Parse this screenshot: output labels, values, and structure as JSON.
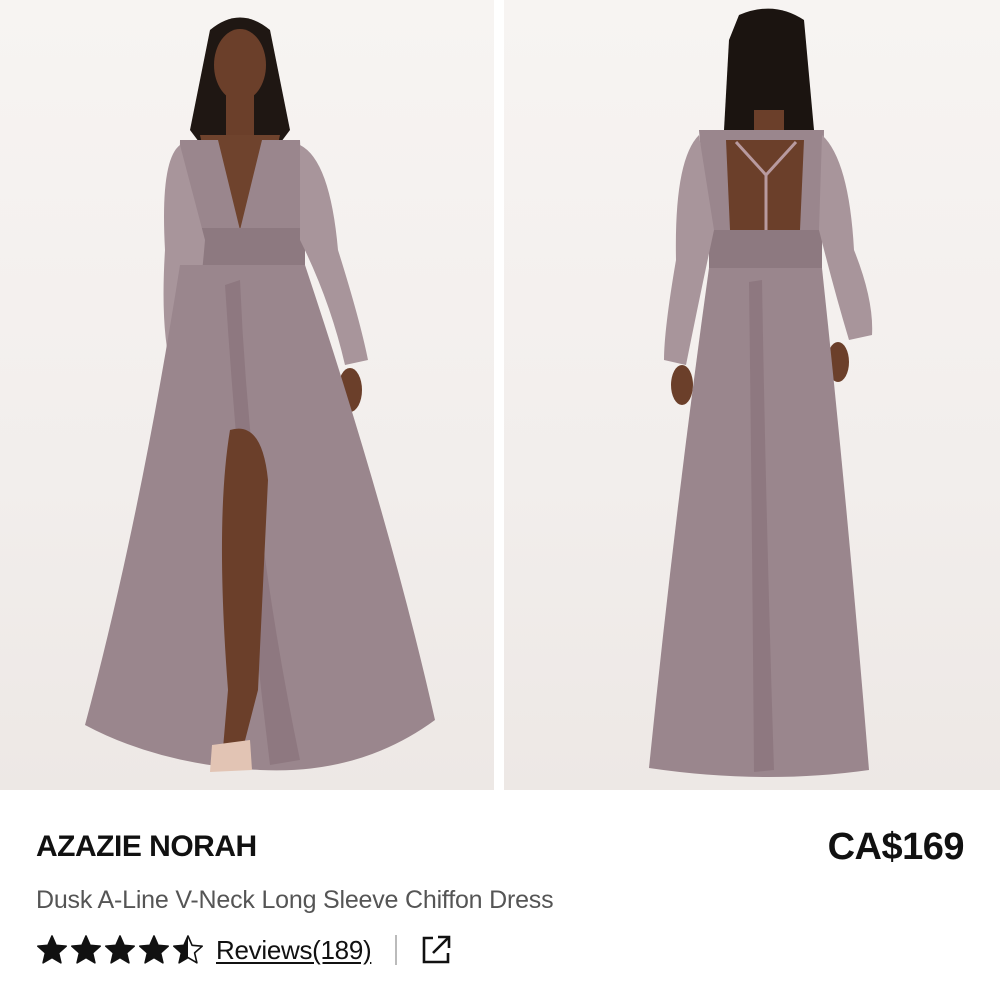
{
  "product": {
    "brand": "AZAZIE NORAH",
    "price": "CA$169",
    "subtitle": "Dusk A-Line V-Neck Long Sleeve Chiffon Dress",
    "rating": 4.5,
    "rating_max": 5,
    "reviews_label": "Reviews(189)"
  },
  "images": [
    {
      "view": "front",
      "alt": "model-front-view"
    },
    {
      "view": "back",
      "alt": "model-back-view"
    }
  ],
  "icons": {
    "star": "star-icon",
    "share": "external-link-icon"
  },
  "colors": {
    "dress": "#9a868d",
    "dress_shadow": "#7d6a72",
    "text": "#111111",
    "subtitle": "#555555"
  }
}
